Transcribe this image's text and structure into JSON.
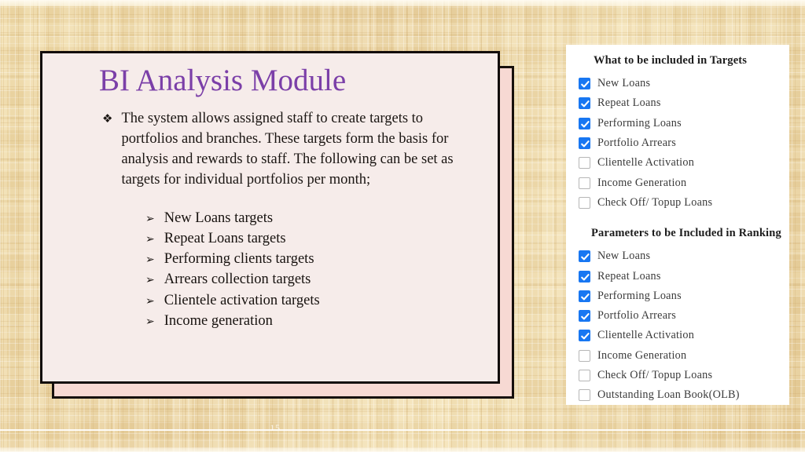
{
  "slide": {
    "title": "BI Analysis Module",
    "page_number": "15",
    "title_color": "#7B3FA8",
    "card_background": "#F6ECEA",
    "card_shadow_color": "#F7D9D3",
    "background_color": "#EDD7A4"
  },
  "intro": {
    "bullet_glyph": "❖",
    "text": "The system allows assigned staff to create targets to portfolios and branches. These targets form the basis for analysis and rewards to staff. The following can be set as targets for individual portfolios per month;"
  },
  "target_list": {
    "bullet_glyph": "➢",
    "items": [
      "New Loans targets",
      "Repeat Loans targets",
      "Performing clients targets",
      "Arrears collection targets",
      "Clientele activation targets",
      "Income generation"
    ]
  },
  "options_panel": {
    "checkbox_checked_color": "#1877F2",
    "checkbox_unchecked_border": "#B6B6B6",
    "sections": [
      {
        "heading": "What to be included in Targets",
        "options": [
          {
            "label": "New Loans",
            "checked": true
          },
          {
            "label": "Repeat Loans",
            "checked": true
          },
          {
            "label": "Performing Loans",
            "checked": true
          },
          {
            "label": "Portfolio Arrears",
            "checked": true
          },
          {
            "label": "Clientelle Activation",
            "checked": false
          },
          {
            "label": "Income Generation",
            "checked": false
          },
          {
            "label": "Check Off/ Topup Loans",
            "checked": false
          }
        ]
      },
      {
        "heading": "Parameters to be Included in Ranking",
        "options": [
          {
            "label": "New Loans",
            "checked": true
          },
          {
            "label": "Repeat Loans",
            "checked": true
          },
          {
            "label": "Performing Loans",
            "checked": true
          },
          {
            "label": "Portfolio Arrears",
            "checked": true
          },
          {
            "label": "Clientelle Activation",
            "checked": true
          },
          {
            "label": "Income Generation",
            "checked": false
          },
          {
            "label": "Check Off/ Topup Loans",
            "checked": false
          },
          {
            "label": "Outstanding Loan Book(OLB)",
            "checked": false
          }
        ]
      }
    ]
  }
}
